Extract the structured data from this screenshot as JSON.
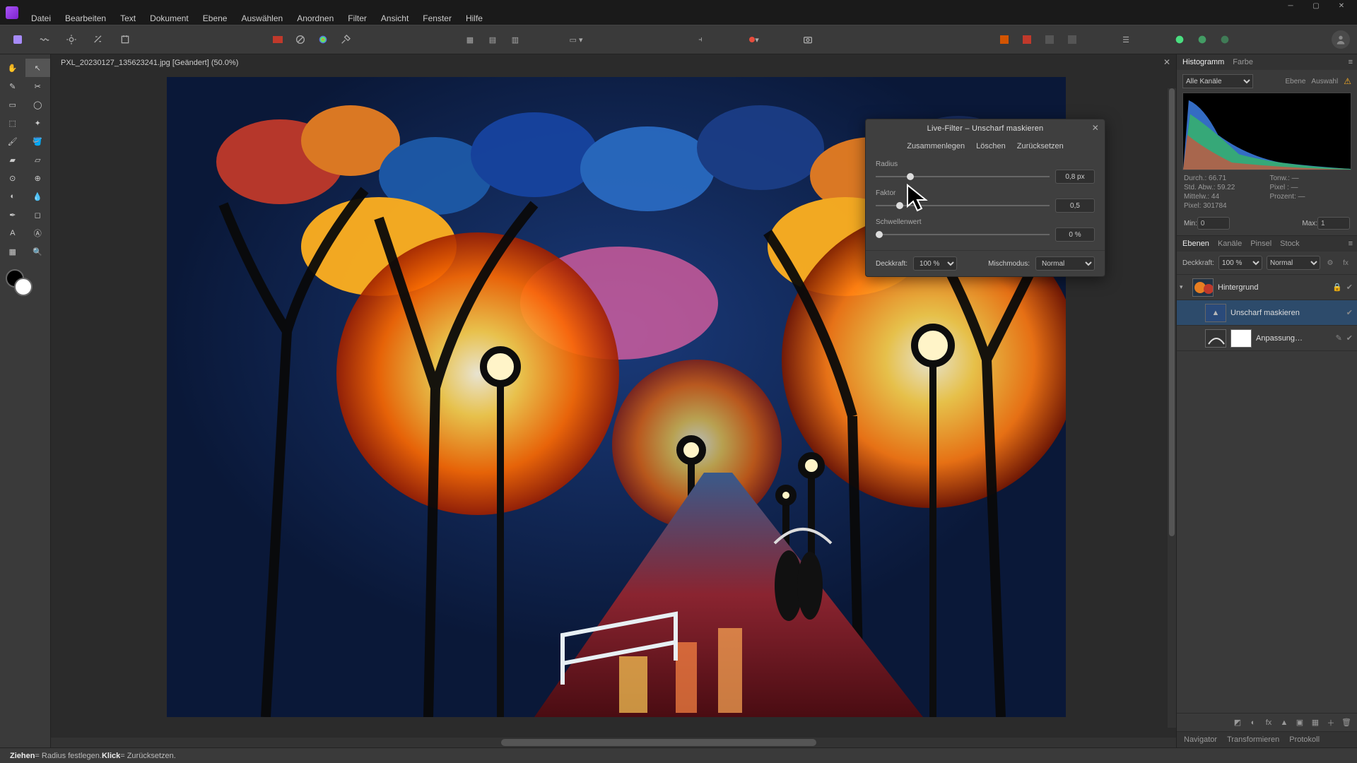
{
  "menu": {
    "items": [
      "Datei",
      "Bearbeiten",
      "Text",
      "Dokument",
      "Ebene",
      "Auswählen",
      "Anordnen",
      "Filter",
      "Ansicht",
      "Fenster",
      "Hilfe"
    ]
  },
  "document": {
    "tab_label": "PXL_20230127_135623241.jpg [Geändert] (50.0%)"
  },
  "dialog": {
    "title": "Live-Filter – Unscharf maskieren",
    "btn_merge": "Zusammenlegen",
    "btn_delete": "Löschen",
    "btn_reset": "Zurücksetzen",
    "radius_label": "Radius",
    "radius_value": "0,8 px",
    "radius_pct": 20,
    "factor_label": "Faktor",
    "factor_value": "0,5",
    "factor_pct": 14,
    "threshold_label": "Schwellenwert",
    "threshold_value": "0 %",
    "threshold_pct": 2,
    "opacity_label": "Deckkraft:",
    "opacity_value": "100 %",
    "blend_label": "Mischmodus:",
    "blend_value": "Normal"
  },
  "histogram": {
    "tabs": [
      "Histogramm",
      "Farbe"
    ],
    "channel": "Alle Kanäle",
    "mini_ebene": "Ebene",
    "mini_auswahl": "Auswahl",
    "stats": {
      "durch": "Durch.: 66.71",
      "abw": "Std. Abw.: 59.22",
      "mittelw": "Mittelw.: 44",
      "pixel": "Pixel: 301784",
      "tonw": "Tonw.: —",
      "pixel2": "Pixel : —",
      "prozent": "Prozent: —"
    },
    "min_label": "Min:",
    "min_value": "0",
    "max_label": "Max:",
    "max_value": "1"
  },
  "layers_panel": {
    "tabs": [
      "Ebenen",
      "Kanäle",
      "Pinsel",
      "Stock"
    ],
    "opacity_label": "Deckkraft:",
    "opacity_value": "100 %",
    "blend_value": "Normal",
    "layers": [
      {
        "name": "Hintergrund",
        "type": "pixel",
        "expanded": true,
        "selected": false
      },
      {
        "name": "Unscharf maskieren",
        "type": "live-filter",
        "selected": true,
        "child": true
      },
      {
        "name": "Anpassung…",
        "type": "adjustment",
        "selected": false,
        "child": true
      }
    ]
  },
  "bottom_tabs": [
    "Navigator",
    "Transformieren",
    "Protokoll"
  ],
  "status": {
    "drag_label": "Ziehen",
    "drag_text": " = Radius festlegen. ",
    "click_label": "Klick",
    "click_text": " = Zurücksetzen."
  }
}
